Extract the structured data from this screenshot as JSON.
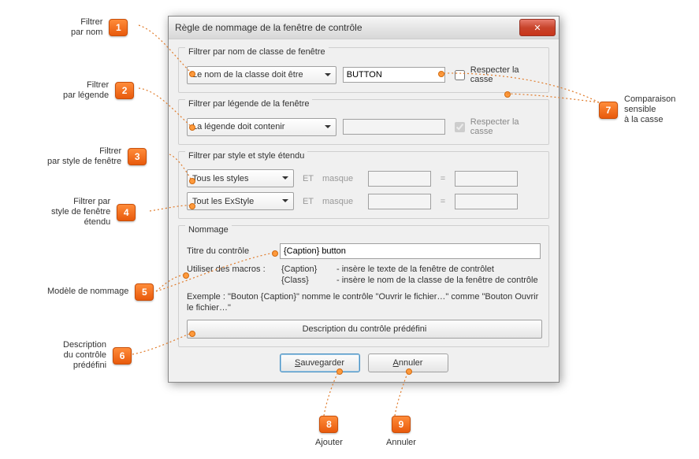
{
  "dialog": {
    "title": "Règle de nommage de la fenêtre de contrôle",
    "close_glyph": "✕"
  },
  "filter_class": {
    "group_label": "Filtrer par nom de classe de fenêtre",
    "mode": "Le nom de la classe doit être",
    "value": "BUTTON",
    "case_label": "Respecter la casse",
    "case_checked": false
  },
  "filter_caption": {
    "group_label": "Filtrer par légende de la fenêtre",
    "mode": "La légende doit contenir",
    "value": "",
    "case_label": "Respecter la casse",
    "case_checked": true,
    "case_disabled": true,
    "value_disabled": true
  },
  "filter_style": {
    "group_label": "Filtrer par style et style étendu",
    "style_mode": "Tous les styles",
    "exstyle_mode": "Tout les ExStyle",
    "conj": "ET",
    "mask_label": "masque",
    "eq": "="
  },
  "naming": {
    "group_label": "Nommage",
    "control_title_label": "Titre du contrôle",
    "control_title_value": "{Caption} button",
    "macro_line_label": "Utiliser des macros :",
    "macro_caption_name": "{Caption}",
    "macro_caption_desc": "- insère le texte de la fenêtre de contrôlet",
    "macro_class_name": "{Class}",
    "macro_class_desc": "- insère le nom de la classe de la fenêtre de contrôle",
    "example_text": "Exemple : \"Bouton {Caption}\" nomme le contrôle \"Ouvrir le fichier…\" comme \"Bouton Ouvrir le fichier…\"",
    "preset_button": "Description du contrôle prédéfini"
  },
  "buttons": {
    "save_prefix": "S",
    "save_rest": "auvegarder",
    "cancel_prefix": "A",
    "cancel_rest": "nnuler"
  },
  "callouts": {
    "c1": "Filtrer\npar nom",
    "c2": "Filtrer\npar légende",
    "c3": "Filtrer\npar style de fenêtre",
    "c4": "Filtrer par\nstyle de fenêtre\nétendu",
    "c5": "Modèle de nommage",
    "c6": "Description\ndu contrôle\nprédéfini",
    "c7": "Comparaison\nsensible\nà la casse",
    "c8": "Ajouter",
    "c9": "Annuler",
    "n1": "1",
    "n2": "2",
    "n3": "3",
    "n4": "4",
    "n5": "5",
    "n6": "6",
    "n7": "7",
    "n8": "8",
    "n9": "9"
  }
}
